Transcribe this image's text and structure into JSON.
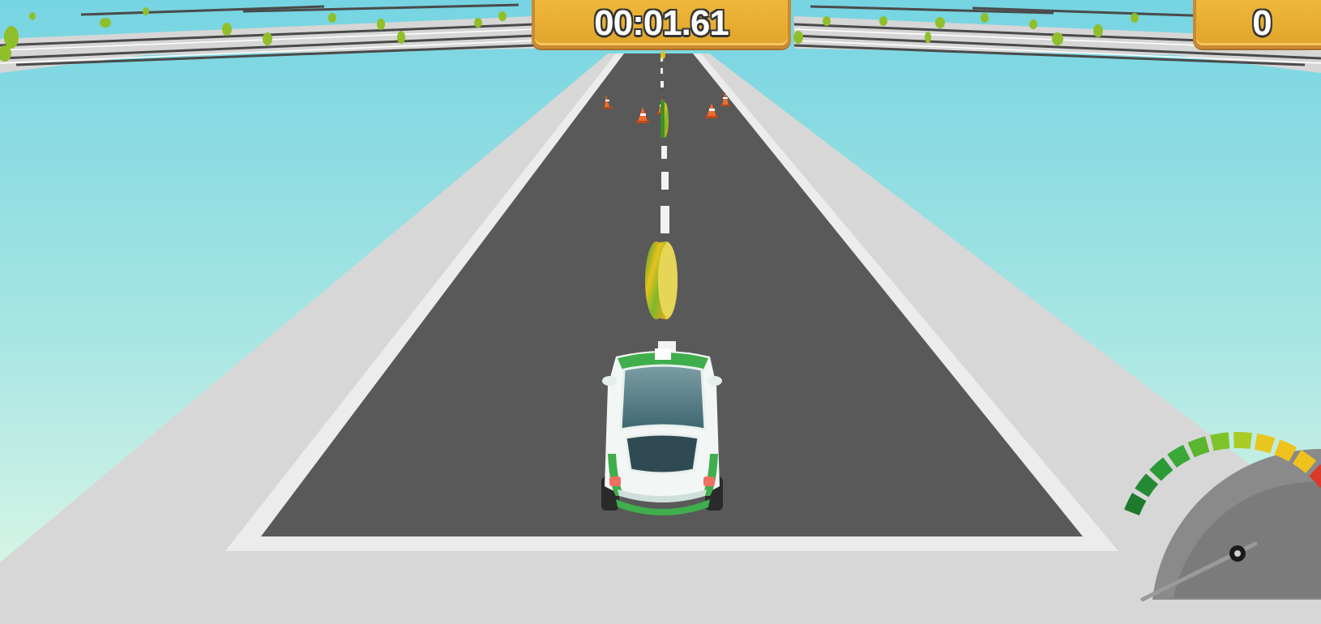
{
  "hud": {
    "timer": "00:01.61",
    "score": "0"
  },
  "speedometer": {
    "level": 0.02
  },
  "colors": {
    "sky_top": "#7fd8e0",
    "sky_bottom": "#dff7e6",
    "road": "#5a5a5a",
    "shoulder": "#d8d8d8",
    "hud_panel": "#e8ad34",
    "car_body": "#f2f6f4",
    "car_stripe": "#3fae4c"
  }
}
